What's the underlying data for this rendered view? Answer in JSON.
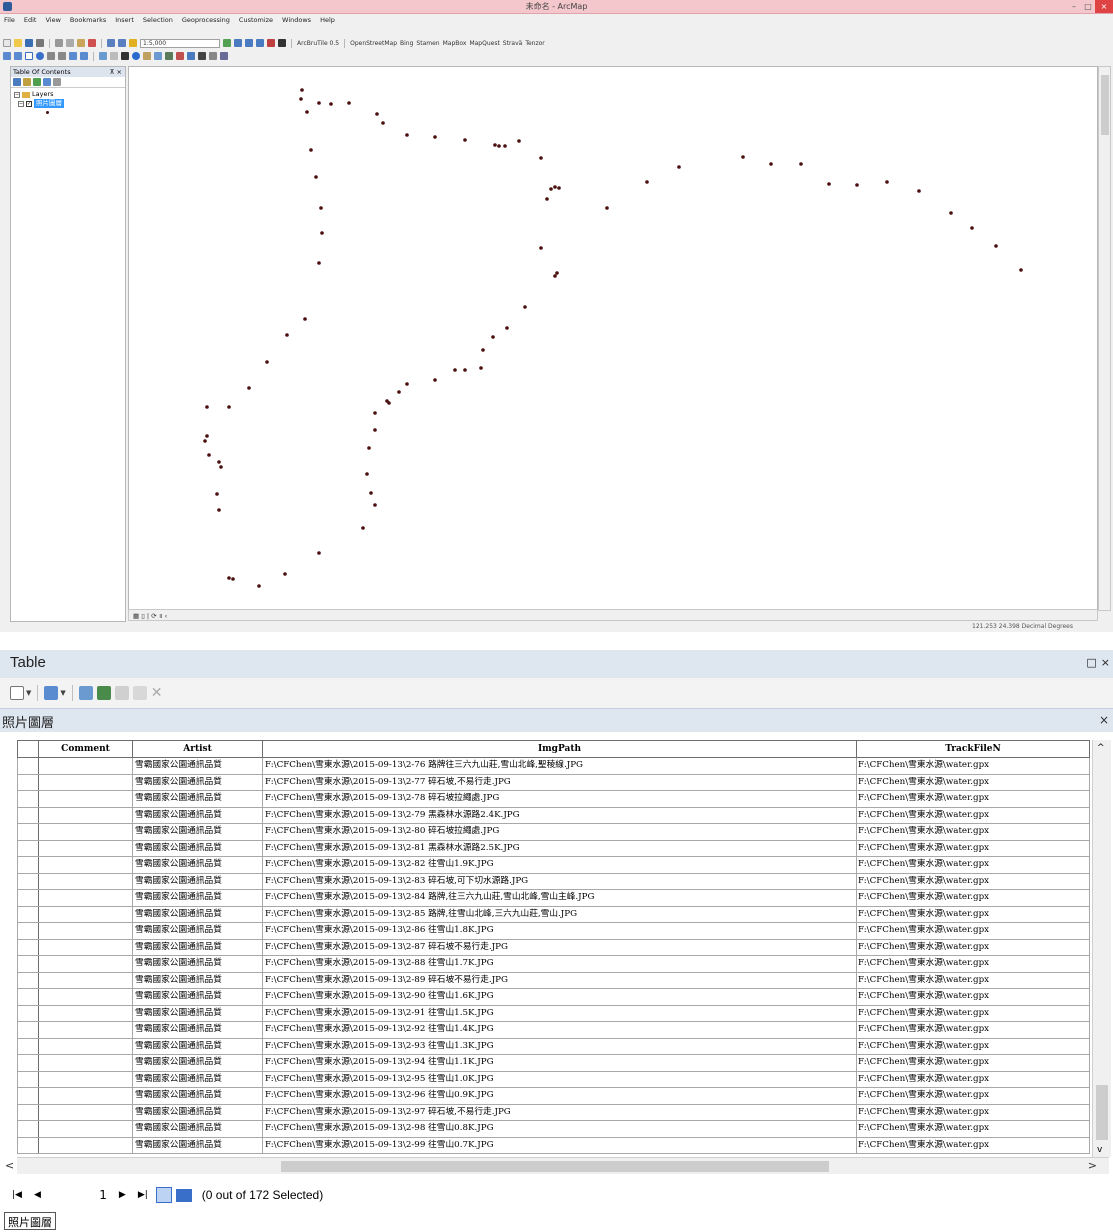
{
  "arcmap": {
    "window_title": "未命名 - ArcMap",
    "menu": [
      "File",
      "Edit",
      "View",
      "Bookmarks",
      "Insert",
      "Selection",
      "Geoprocessing",
      "Customize",
      "Windows",
      "Help"
    ],
    "toolbar_ext": [
      "ArcBruTile 0.5",
      "OpenStreetMap",
      "Bing",
      "Stamen",
      "MapBox",
      "MapQuest",
      "Stravä",
      "Tenzor"
    ],
    "scale": "1:5,000",
    "toc": {
      "title": "Table Of Contents",
      "root": "Layers",
      "layer": "照片圖層"
    },
    "coords": "121.253  24.398 Decimal Degrees",
    "point_color": "#4a1010"
  },
  "table_window": {
    "title": "Table",
    "layer_tab": "照片圖層",
    "columns": [
      "Comment",
      "Artist",
      "ImgPath",
      "TrackFileN"
    ],
    "rows": [
      {
        "comment": "",
        "artist": "雪霸國家公園通訊品質",
        "imgpath": "F:\\CFChen\\雪東水源\\2015-09-13\\2-76 路牌往三六九山莊,雪山北峰,聖稜線.JPG",
        "track": "F:\\CFChen\\雪東水源\\water.gpx"
      },
      {
        "comment": "",
        "artist": "雪霸國家公園通訊品質",
        "imgpath": "F:\\CFChen\\雪東水源\\2015-09-13\\2-77 碎石坡,不易行走.JPG",
        "track": "F:\\CFChen\\雪東水源\\water.gpx"
      },
      {
        "comment": "",
        "artist": "雪霸國家公園通訊品質",
        "imgpath": "F:\\CFChen\\雪東水源\\2015-09-13\\2-78 碎石坡拉繩處.JPG",
        "track": "F:\\CFChen\\雪東水源\\water.gpx"
      },
      {
        "comment": "",
        "artist": "雪霸國家公園通訊品質",
        "imgpath": "F:\\CFChen\\雪東水源\\2015-09-13\\2-79 黑森林水源路2.4K.JPG",
        "track": "F:\\CFChen\\雪東水源\\water.gpx"
      },
      {
        "comment": "",
        "artist": "雪霸國家公園通訊品質",
        "imgpath": "F:\\CFChen\\雪東水源\\2015-09-13\\2-80 碎石坡拉繩處.JPG",
        "track": "F:\\CFChen\\雪東水源\\water.gpx"
      },
      {
        "comment": "",
        "artist": "雪霸國家公園通訊品質",
        "imgpath": "F:\\CFChen\\雪東水源\\2015-09-13\\2-81 黑森林水源路2.5K.JPG",
        "track": "F:\\CFChen\\雪東水源\\water.gpx"
      },
      {
        "comment": "",
        "artist": "雪霸國家公園通訊品質",
        "imgpath": "F:\\CFChen\\雪東水源\\2015-09-13\\2-82 往雪山1.9K.JPG",
        "track": "F:\\CFChen\\雪東水源\\water.gpx"
      },
      {
        "comment": "",
        "artist": "雪霸國家公園通訊品質",
        "imgpath": "F:\\CFChen\\雪東水源\\2015-09-13\\2-83 碎石坡,可下切水源路.JPG",
        "track": "F:\\CFChen\\雪東水源\\water.gpx"
      },
      {
        "comment": "",
        "artist": "雪霸國家公園通訊品質",
        "imgpath": "F:\\CFChen\\雪東水源\\2015-09-13\\2-84 路牌,往三六九山莊,雪山北峰,雪山主峰.JPG",
        "track": "F:\\CFChen\\雪東水源\\water.gpx"
      },
      {
        "comment": "",
        "artist": "雪霸國家公園通訊品質",
        "imgpath": "F:\\CFChen\\雪東水源\\2015-09-13\\2-85 路牌,往雪山北峰,三六九山莊,雪山.JPG",
        "track": "F:\\CFChen\\雪東水源\\water.gpx"
      },
      {
        "comment": "",
        "artist": "雪霸國家公園通訊品質",
        "imgpath": "F:\\CFChen\\雪東水源\\2015-09-13\\2-86 往雪山1.8K.JPG",
        "track": "F:\\CFChen\\雪東水源\\water.gpx"
      },
      {
        "comment": "",
        "artist": "雪霸國家公園通訊品質",
        "imgpath": "F:\\CFChen\\雪東水源\\2015-09-13\\2-87 碎石坡不易行走.JPG",
        "track": "F:\\CFChen\\雪東水源\\water.gpx"
      },
      {
        "comment": "",
        "artist": "雪霸國家公園通訊品質",
        "imgpath": "F:\\CFChen\\雪東水源\\2015-09-13\\2-88 往雪山1.7K.JPG",
        "track": "F:\\CFChen\\雪東水源\\water.gpx"
      },
      {
        "comment": "",
        "artist": "雪霸國家公園通訊品質",
        "imgpath": "F:\\CFChen\\雪東水源\\2015-09-13\\2-89 碎石坡不易行走.JPG",
        "track": "F:\\CFChen\\雪東水源\\water.gpx"
      },
      {
        "comment": "",
        "artist": "雪霸國家公園通訊品質",
        "imgpath": "F:\\CFChen\\雪東水源\\2015-09-13\\2-90 往雪山1.6K.JPG",
        "track": "F:\\CFChen\\雪東水源\\water.gpx"
      },
      {
        "comment": "",
        "artist": "雪霸國家公園通訊品質",
        "imgpath": "F:\\CFChen\\雪東水源\\2015-09-13\\2-91 往雪山1.5K.JPG",
        "track": "F:\\CFChen\\雪東水源\\water.gpx"
      },
      {
        "comment": "",
        "artist": "雪霸國家公園通訊品質",
        "imgpath": "F:\\CFChen\\雪東水源\\2015-09-13\\2-92 往雪山1.4K.JPG",
        "track": "F:\\CFChen\\雪東水源\\water.gpx"
      },
      {
        "comment": "",
        "artist": "雪霸國家公園通訊品質",
        "imgpath": "F:\\CFChen\\雪東水源\\2015-09-13\\2-93 往雪山1.3K.JPG",
        "track": "F:\\CFChen\\雪東水源\\water.gpx"
      },
      {
        "comment": "",
        "artist": "雪霸國家公園通訊品質",
        "imgpath": "F:\\CFChen\\雪東水源\\2015-09-13\\2-94 往雪山1.1K.JPG",
        "track": "F:\\CFChen\\雪東水源\\water.gpx"
      },
      {
        "comment": "",
        "artist": "雪霸國家公園通訊品質",
        "imgpath": "F:\\CFChen\\雪東水源\\2015-09-13\\2-95 往雪山1.0K.JPG",
        "track": "F:\\CFChen\\雪東水源\\water.gpx"
      },
      {
        "comment": "",
        "artist": "雪霸國家公園通訊品質",
        "imgpath": "F:\\CFChen\\雪東水源\\2015-09-13\\2-96 往雪山0.9K.JPG",
        "track": "F:\\CFChen\\雪東水源\\water.gpx"
      },
      {
        "comment": "",
        "artist": "雪霸國家公園通訊品質",
        "imgpath": "F:\\CFChen\\雪東水源\\2015-09-13\\2-97 碎石坡,不易行走.JPG",
        "track": "F:\\CFChen\\雪東水源\\water.gpx"
      },
      {
        "comment": "",
        "artist": "雪霸國家公園通訊品質",
        "imgpath": "F:\\CFChen\\雪東水源\\2015-09-13\\2-98 往雪山0.8K.JPG",
        "track": "F:\\CFChen\\雪東水源\\water.gpx"
      },
      {
        "comment": "",
        "artist": "雪霸國家公園通訊品質",
        "imgpath": "F:\\CFChen\\雪東水源\\2015-09-13\\2-99 往雪山0.7K.JPG",
        "track": "F:\\CFChen\\雪東水源\\water.gpx"
      }
    ],
    "record": "1",
    "selection_status": "(0 out of 172 Selected)",
    "bottom_tab": "照片圖層"
  }
}
